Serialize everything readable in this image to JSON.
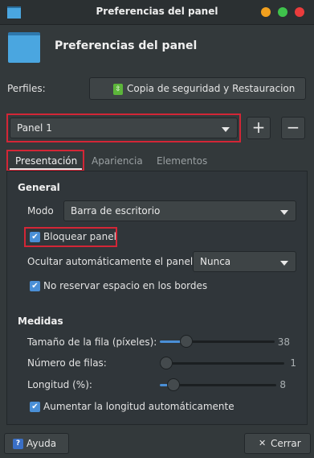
{
  "window": {
    "title": "Preferencias del panel"
  },
  "header": {
    "title": "Preferencias del panel"
  },
  "profiles": {
    "label": "Perfiles:",
    "button_label": "Copia de seguridad y Restauracion"
  },
  "panel_select": {
    "value": "Panel 1",
    "add_label": "+",
    "remove_label": "−"
  },
  "tabs": [
    {
      "label": "Presentación"
    },
    {
      "label": "Apariencia"
    },
    {
      "label": "Elementos"
    }
  ],
  "general": {
    "heading": "General",
    "mode_label": "Modo",
    "mode_value": "Barra de escritorio",
    "lock_label": "Bloquear panel",
    "lock_checked": true,
    "autohide_label": "Ocultar automáticamente el panel:",
    "autohide_value": "Nunca",
    "no_reserve_label": "No reservar espacio en los bordes",
    "no_reserve_checked": true
  },
  "measures": {
    "heading": "Medidas",
    "row_size_label": "Tamaño de la fila (píxeles):",
    "row_size_value": "38",
    "row_size_fraction": 0.2,
    "rows_label": "Número de filas:",
    "rows_value": "1",
    "rows_fraction": 0.0,
    "length_label": "Longitud (%):",
    "length_value": "8",
    "length_fraction": 0.07,
    "auto_length_label": "Aumentar la longitud automáticamente",
    "auto_length_checked": true
  },
  "footer": {
    "help_label": "Ayuda",
    "close_label": "Cerrar"
  },
  "icons": {
    "check": "✔",
    "help": "?",
    "close": "✕",
    "backup": "⇳"
  }
}
